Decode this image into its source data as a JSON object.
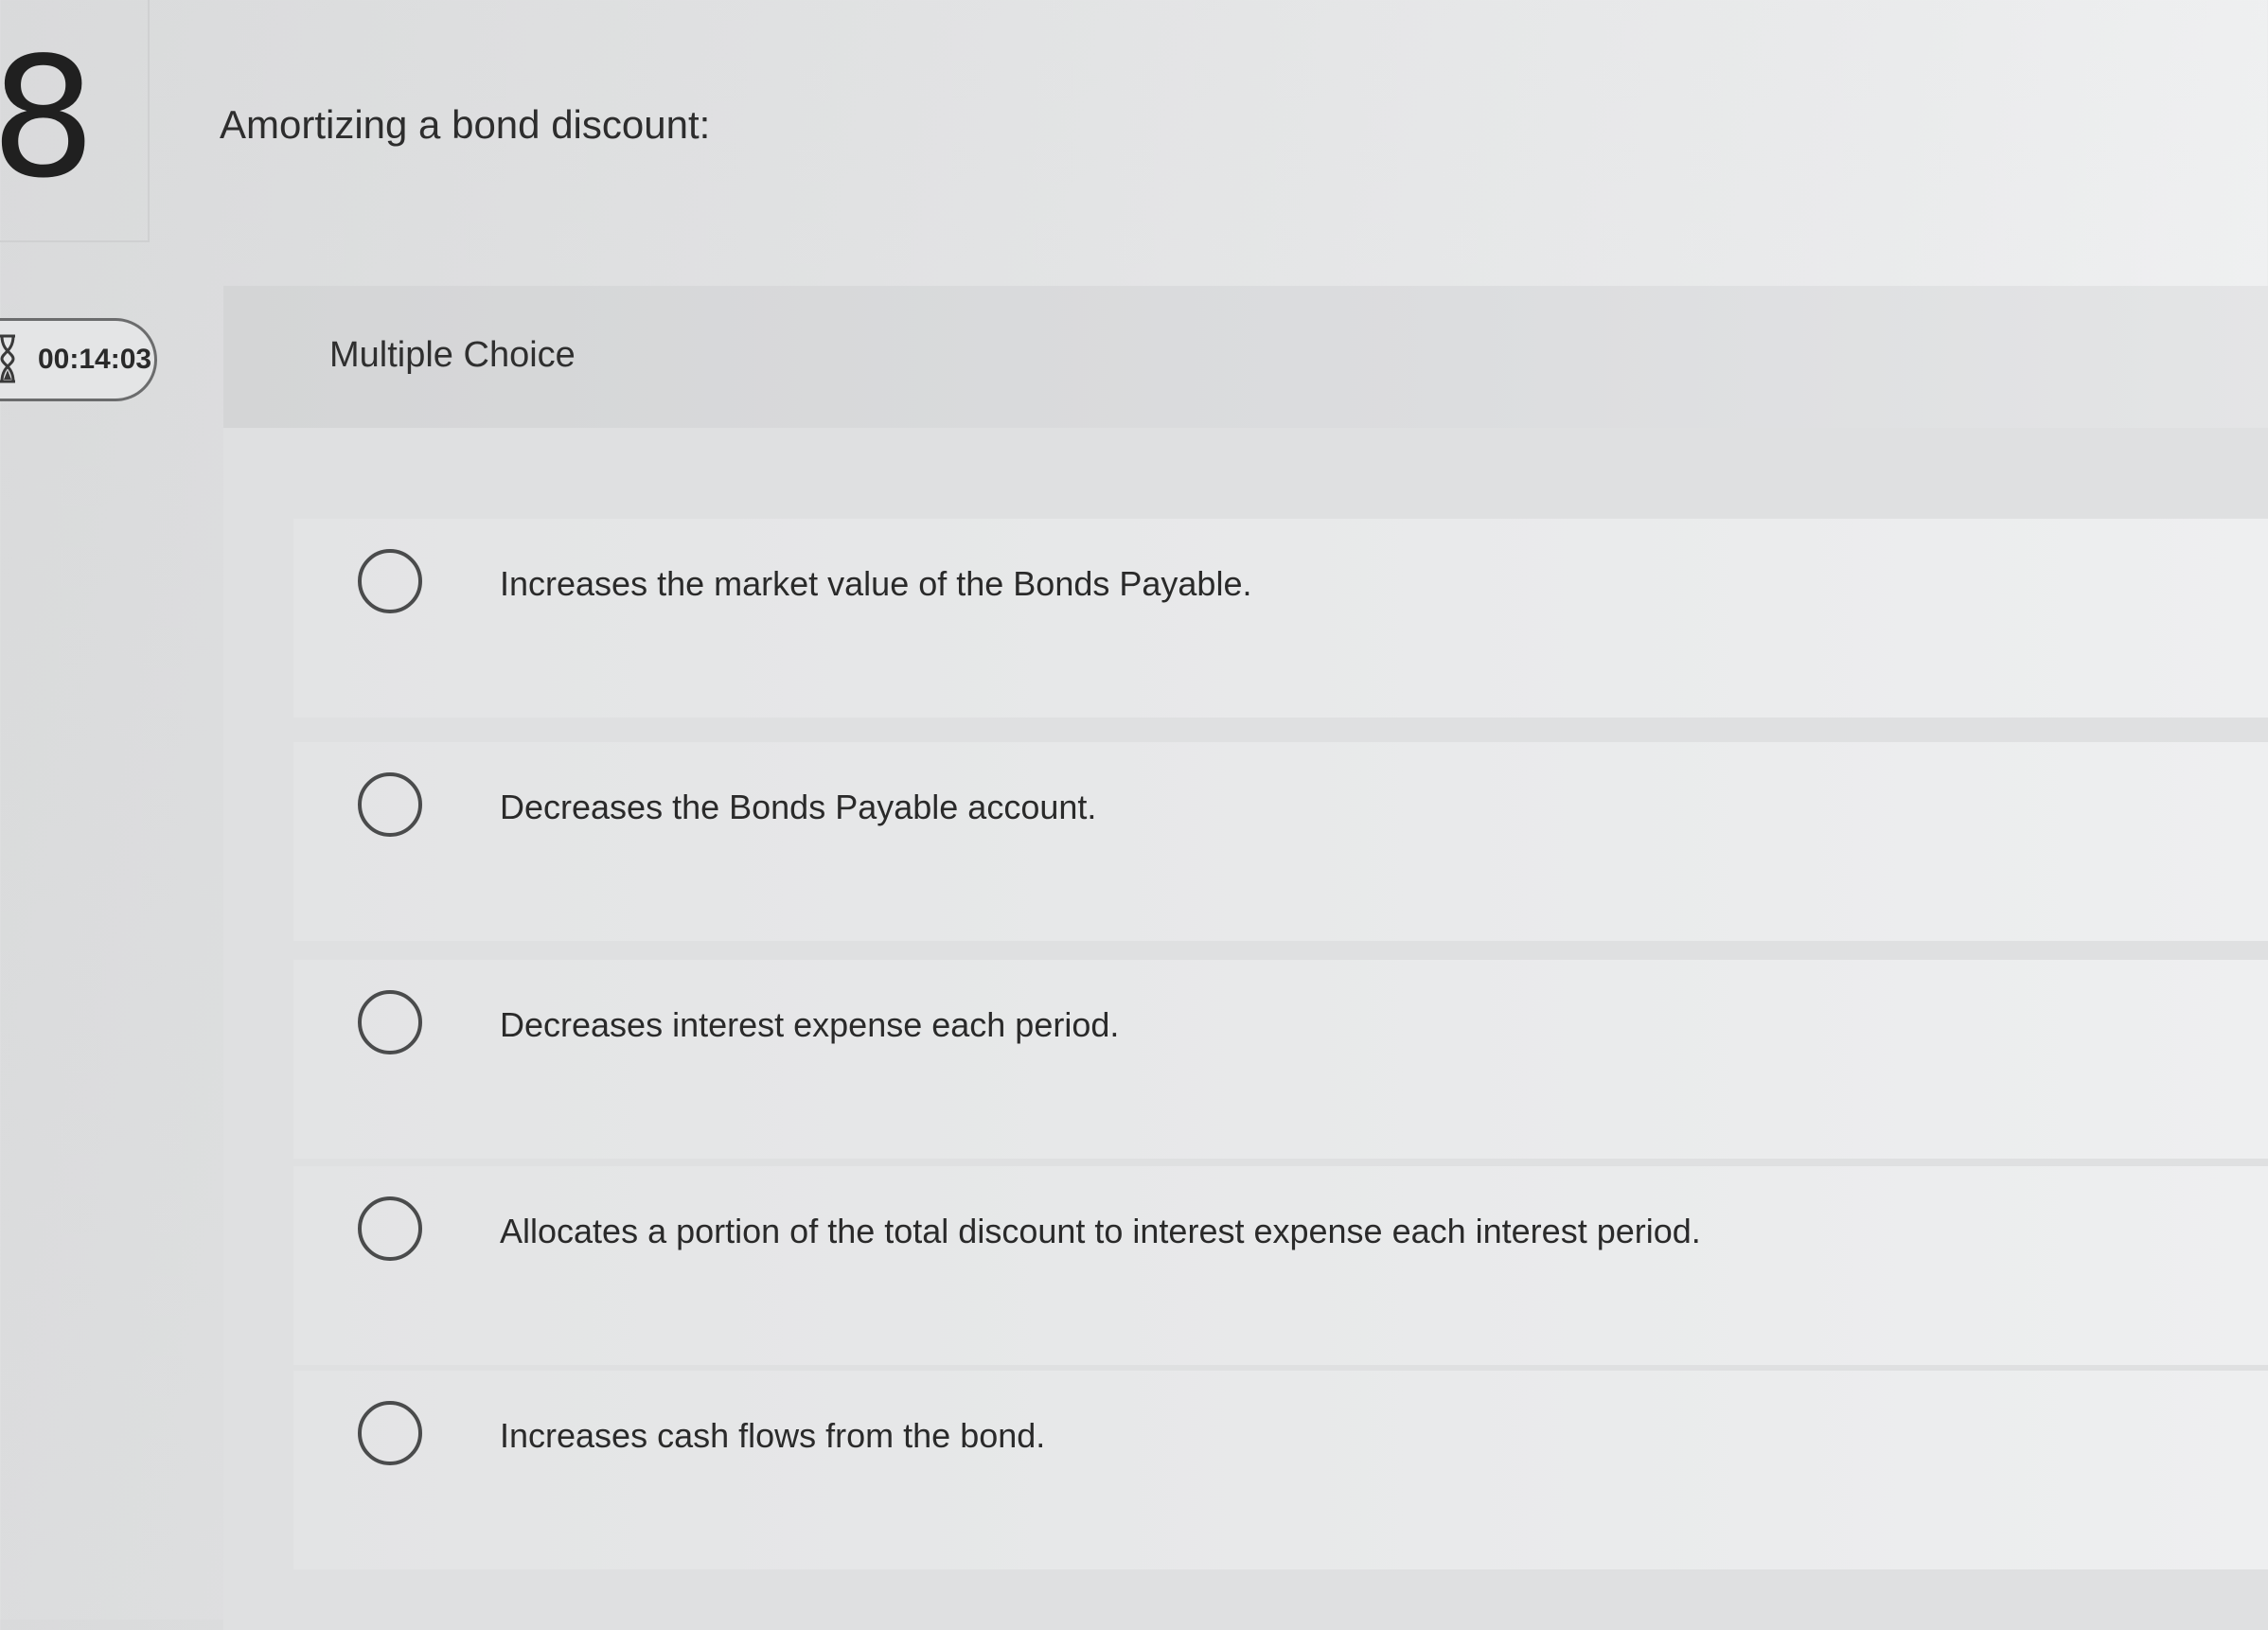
{
  "question": {
    "number": "8",
    "text": "Amortizing a bond discount:"
  },
  "timer": {
    "icon": "hourglass-icon",
    "time": "00:14:03"
  },
  "panel": {
    "label": "Multiple Choice"
  },
  "options": [
    {
      "label": "Increases the market value of the Bonds Payable."
    },
    {
      "label": "Decreases the Bonds Payable account."
    },
    {
      "label": "Decreases interest expense each period."
    },
    {
      "label": "Allocates a portion of the total discount to interest expense each interest period."
    },
    {
      "label": "Increases cash flows from the bond."
    }
  ]
}
